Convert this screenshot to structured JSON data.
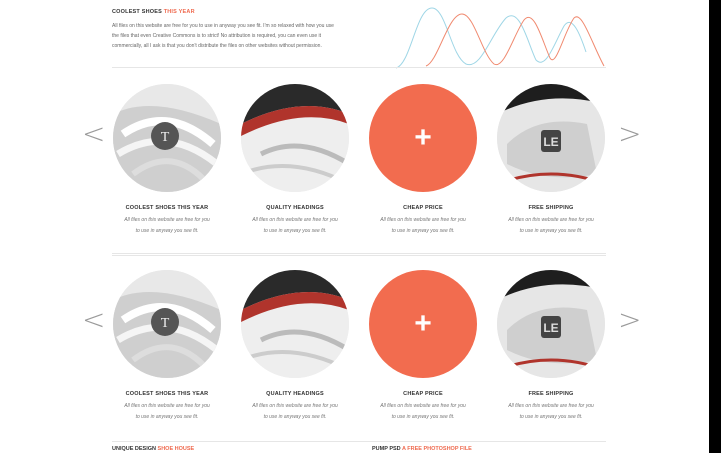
{
  "intro": {
    "heading_main": "COOLEST SHOES",
    "heading_accent": "THIS YEAR",
    "lines": [
      "All files on this website are free for you to use in anyway you see fit. I'm so relaxed with how you use",
      "the files that even Creative Commons is to strict! No attribution is required, you can even use it",
      "commercially, all I ask is that you don't distribute the files on other websites without permission."
    ]
  },
  "colors": {
    "accent": "#ef6a4f",
    "plus_bg": "#f26c4f",
    "wave_red": "#f08a70",
    "wave_blue": "#9fd6e6"
  },
  "sliders": [
    {
      "prev": "<",
      "next": ">",
      "items": [
        {
          "title": "COOLEST SHOES THIS YEAR",
          "text1": "All files on this website are free for you",
          "text2": "to use in anyway you see fit.",
          "image": "shoe-laces"
        },
        {
          "title": "QUALITY HEADINGS",
          "text1": "All files on this website are free for you",
          "text2": "to use in anyway you see fit.",
          "image": "shoe-side"
        },
        {
          "title": "CHEAP PRICE",
          "text1": "All files on this website are free for you",
          "text2": "to use in anyway you see fit.",
          "image": "plus-icon",
          "plus": "+"
        },
        {
          "title": "FREE SHIPPING",
          "text1": "All files on this website are free for you",
          "text2": "to use in anyway you see fit.",
          "image": "shoe-logo"
        }
      ]
    },
    {
      "prev": "<",
      "next": ">",
      "items": [
        {
          "title": "COOLEST SHOES THIS YEAR",
          "text1": "All files on this website are free for you",
          "text2": "to use in anyway you see fit.",
          "image": "shoe-laces"
        },
        {
          "title": "QUALITY HEADINGS",
          "text1": "All files on this website are free for you",
          "text2": "to use in anyway you see fit.",
          "image": "shoe-side"
        },
        {
          "title": "CHEAP PRICE",
          "text1": "All files on this website are free for you",
          "text2": "to use in anyway you see fit.",
          "image": "plus-icon",
          "plus": "+"
        },
        {
          "title": "FREE SHIPPING",
          "text1": "All files on this website are free for you",
          "text2": "to use in anyway you see fit.",
          "image": "shoe-logo"
        }
      ]
    }
  ],
  "footer": {
    "left_main": "UNIQUE DESIGN",
    "left_accent": "SHOE HOUSE",
    "right_main": "PUMP PSD",
    "right_accent": "A FREE PHOTOSHOP FILE"
  }
}
